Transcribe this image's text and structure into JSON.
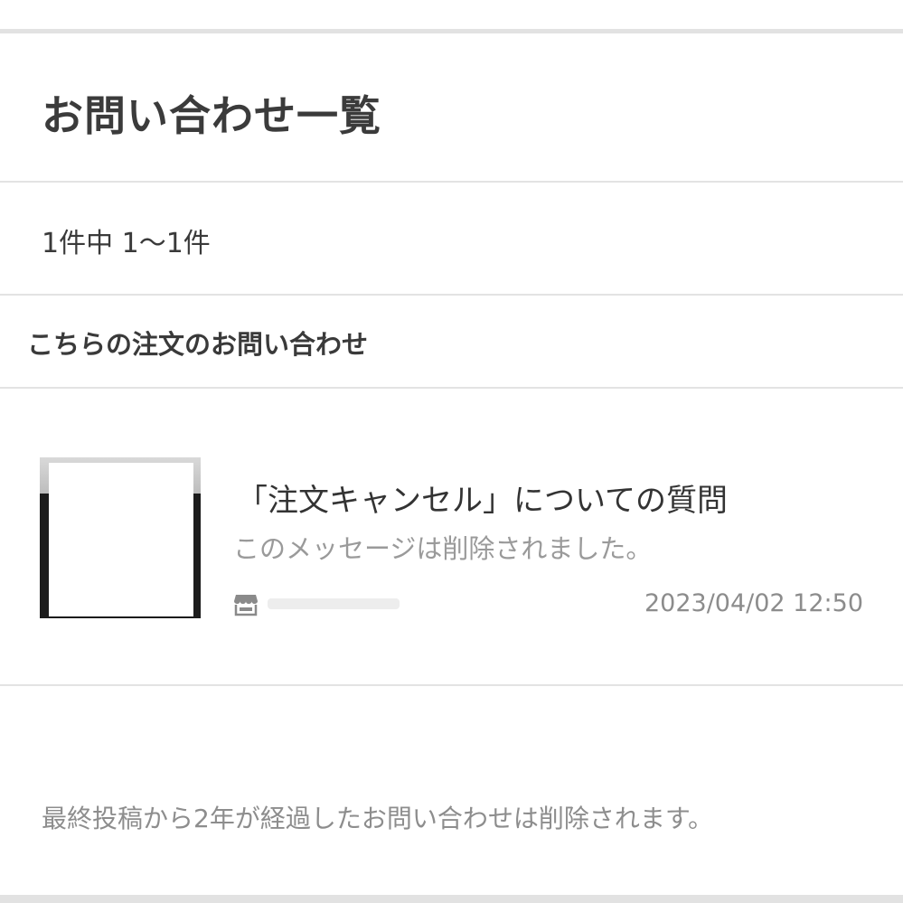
{
  "header": {
    "title": "お問い合わせ一覧"
  },
  "list": {
    "count_text": "1件中 1〜1件",
    "section_heading": "こちらの注文のお問い合わせ",
    "items": [
      {
        "title": "「注文キャンセル」についての質問",
        "message": "このメッセージは削除されました。",
        "shop_icon": "storefront-icon",
        "date": "2023/04/02 12:50"
      }
    ]
  },
  "footer": {
    "note": "最終投稿から2年が経過したお問い合わせは削除されます。"
  },
  "colors": {
    "divider": "#e3e3e3",
    "muted_text": "#9a9a9a"
  }
}
